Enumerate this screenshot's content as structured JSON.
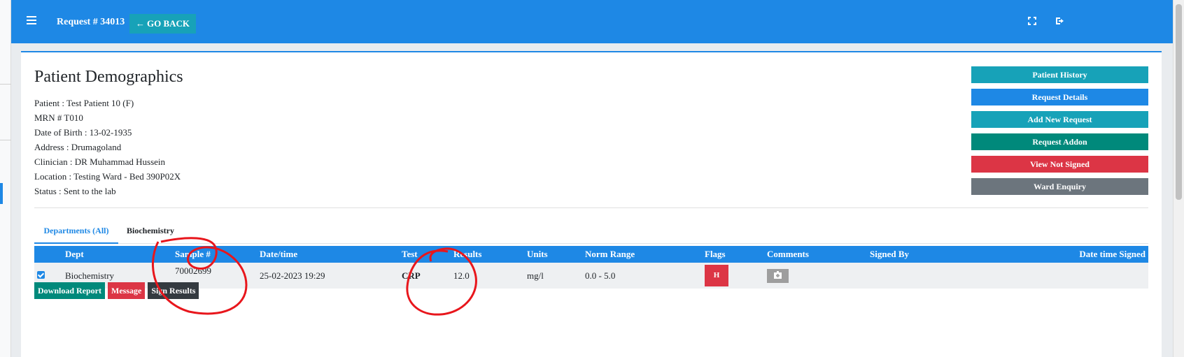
{
  "header": {
    "request_title": "Request # 34013",
    "go_back_label": "GO BACK"
  },
  "demographics": {
    "title": "Patient Demographics",
    "lines": [
      "Patient : Test Patient 10 (F)",
      "MRN # T010",
      "Date of Birth : 13-02-1935",
      "Address : Drumagoland",
      "Clinician : DR Muhammad Hussein",
      "Location : Testing Ward - Bed 390P02X",
      "Status : Sent to the lab"
    ]
  },
  "side_buttons": [
    {
      "label": "Patient History",
      "color": "#17a2b8"
    },
    {
      "label": "Request Details",
      "color": "#1e88e5"
    },
    {
      "label": "Add New Request",
      "color": "#17a2b8"
    },
    {
      "label": "Request Addon",
      "color": "#00897b"
    },
    {
      "label": "View Not Signed",
      "color": "#dc3545"
    },
    {
      "label": "Ward Enquiry",
      "color": "#6c757d"
    }
  ],
  "tabs": [
    "Departments (All)",
    "Biochemistry"
  ],
  "table": {
    "columns": [
      "Dept",
      "Sample #",
      "Date/time",
      "Test",
      "Results",
      "Units",
      "Norm Range",
      "Flags",
      "Comments",
      "Signed By",
      "Date time Signed"
    ],
    "rows": [
      {
        "checked": true,
        "dept": "Biochemistry",
        "sample": "70002699",
        "datetime": "25-02-2023 19:29",
        "test": "CRP",
        "result": "12.0",
        "units": "mg/l",
        "range": "0.0 - 5.0",
        "flag": "H",
        "signed_by": "",
        "date_signed": ""
      }
    ]
  },
  "actions": [
    {
      "label": "Download Report",
      "color": "#00897b"
    },
    {
      "label": "Message",
      "color": "#dc3545"
    },
    {
      "label": "Sign Results",
      "color": "#343a40"
    }
  ]
}
